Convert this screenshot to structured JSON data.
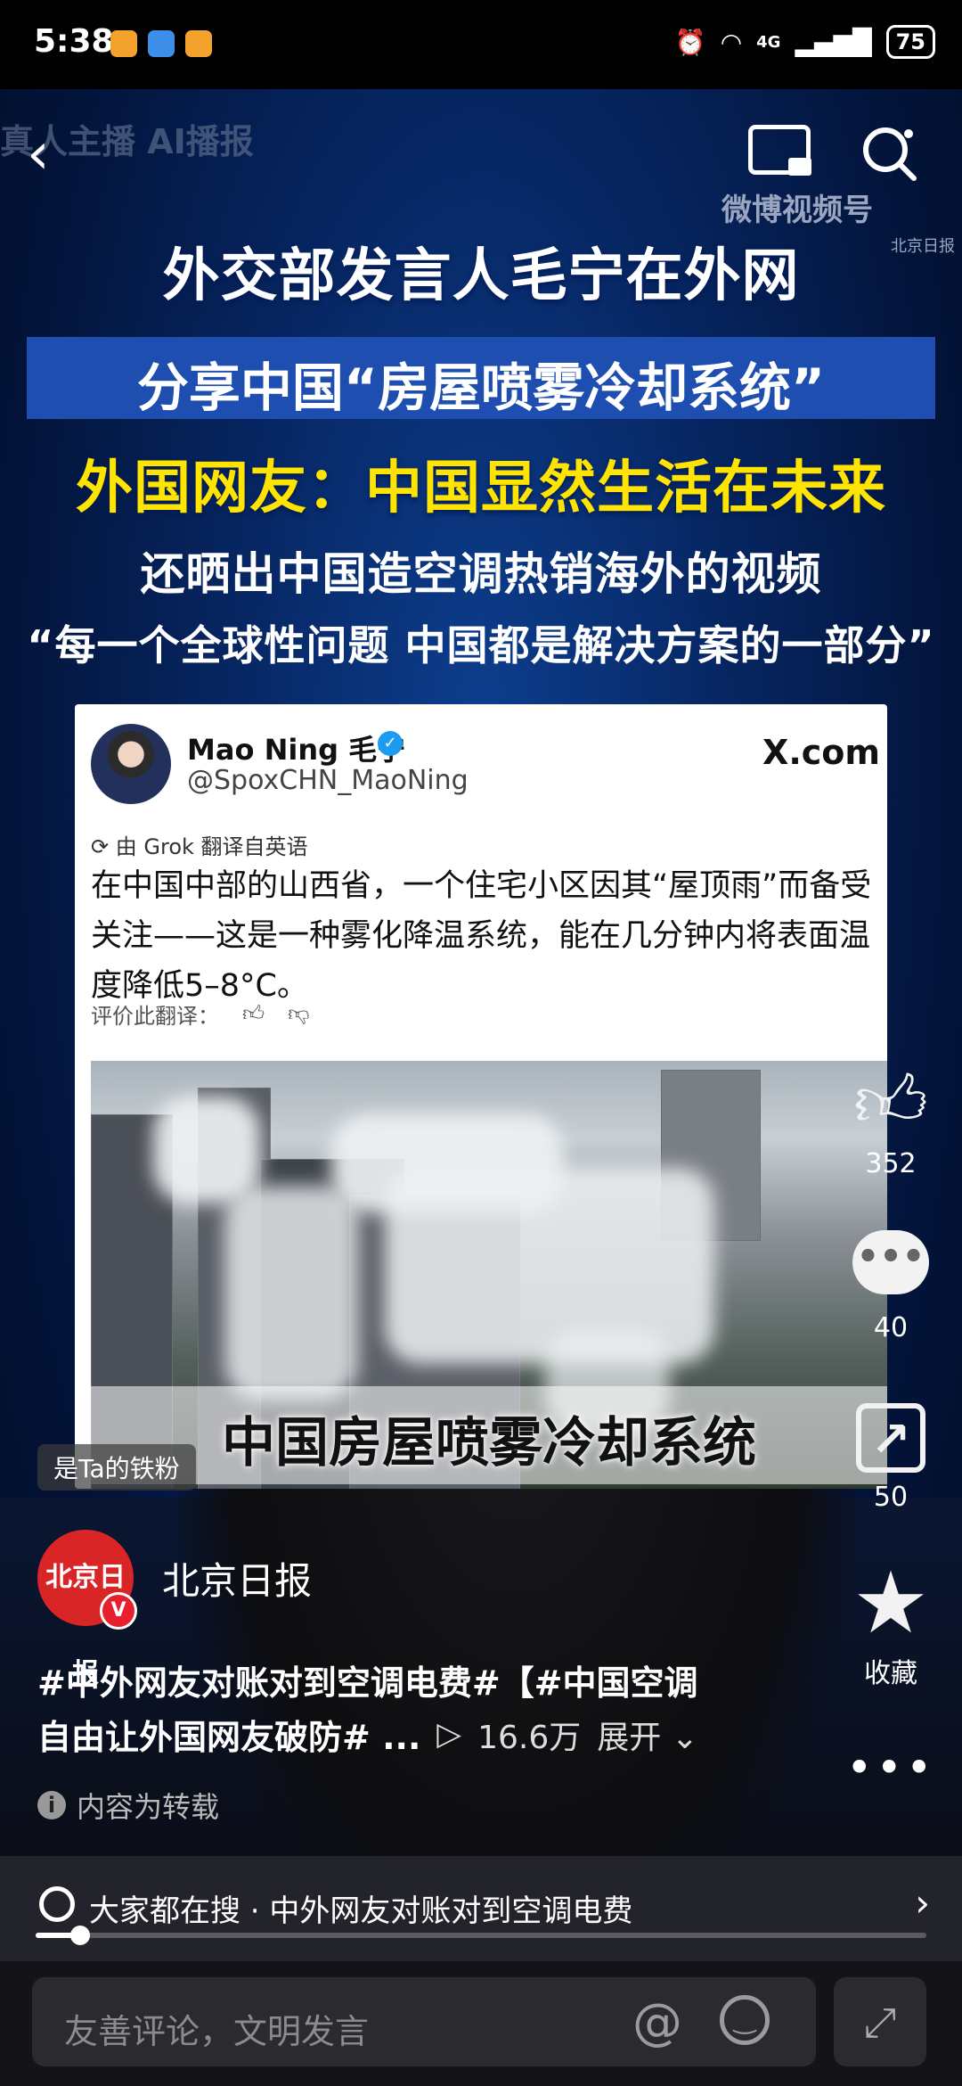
{
  "status_bar": {
    "time": "5:38",
    "network": "4G",
    "battery": "75"
  },
  "video": {
    "bg_tag": "真人主播 AI播报",
    "watermark": "微博视频号",
    "watermark_source": "北京日报",
    "headlines": [
      "外交部发言人毛宁在外网",
      "分享中国“房屋喷雾冷却系统”",
      "外国网友：中国显然生活在未来",
      "还晒出中国造空调热销海外的视频",
      "“每一个全球性问题 中国都是解决方案的一部分”"
    ],
    "headline_colors": {
      "white": "#ffffff",
      "yellow": "#ffe400",
      "banner": "#1d4eb0"
    }
  },
  "tweet": {
    "name": "Mao Ning 毛宁",
    "handle": "@SpoxCHN_MaoNing",
    "site": "X.com",
    "translate_note": "由 Grok 翻译自英语",
    "body": "在中国中部的山西省，一个住宅小区因其“屋顶雨”而备受关注——这是一种雾化降温系统，能在几分钟内将表面温度降低5–8°C。",
    "rate_label": "评价此翻译：",
    "media_caption": "中国房屋喷雾冷却系统"
  },
  "rail": {
    "likes": "352",
    "comments": "40",
    "shares": "50",
    "favorite_label": "收藏"
  },
  "overlay": {
    "fan_tag": "是Ta的铁粉",
    "author_name": "北京日报",
    "author_avatar_text": "北京日报",
    "caption_line1": "#中外网友对账对到空调电费#【#中国空调",
    "caption_line2": "自由让外国网友破防# ...",
    "views": "16.6万",
    "expand_label": "展开",
    "repost_note": "内容为转载"
  },
  "hot_search": {
    "text": "大家都在搜 · 中外网友对账对到空调电费",
    "progress": 0.05
  },
  "comment_bar": {
    "placeholder": "友善评论，文明发言"
  }
}
